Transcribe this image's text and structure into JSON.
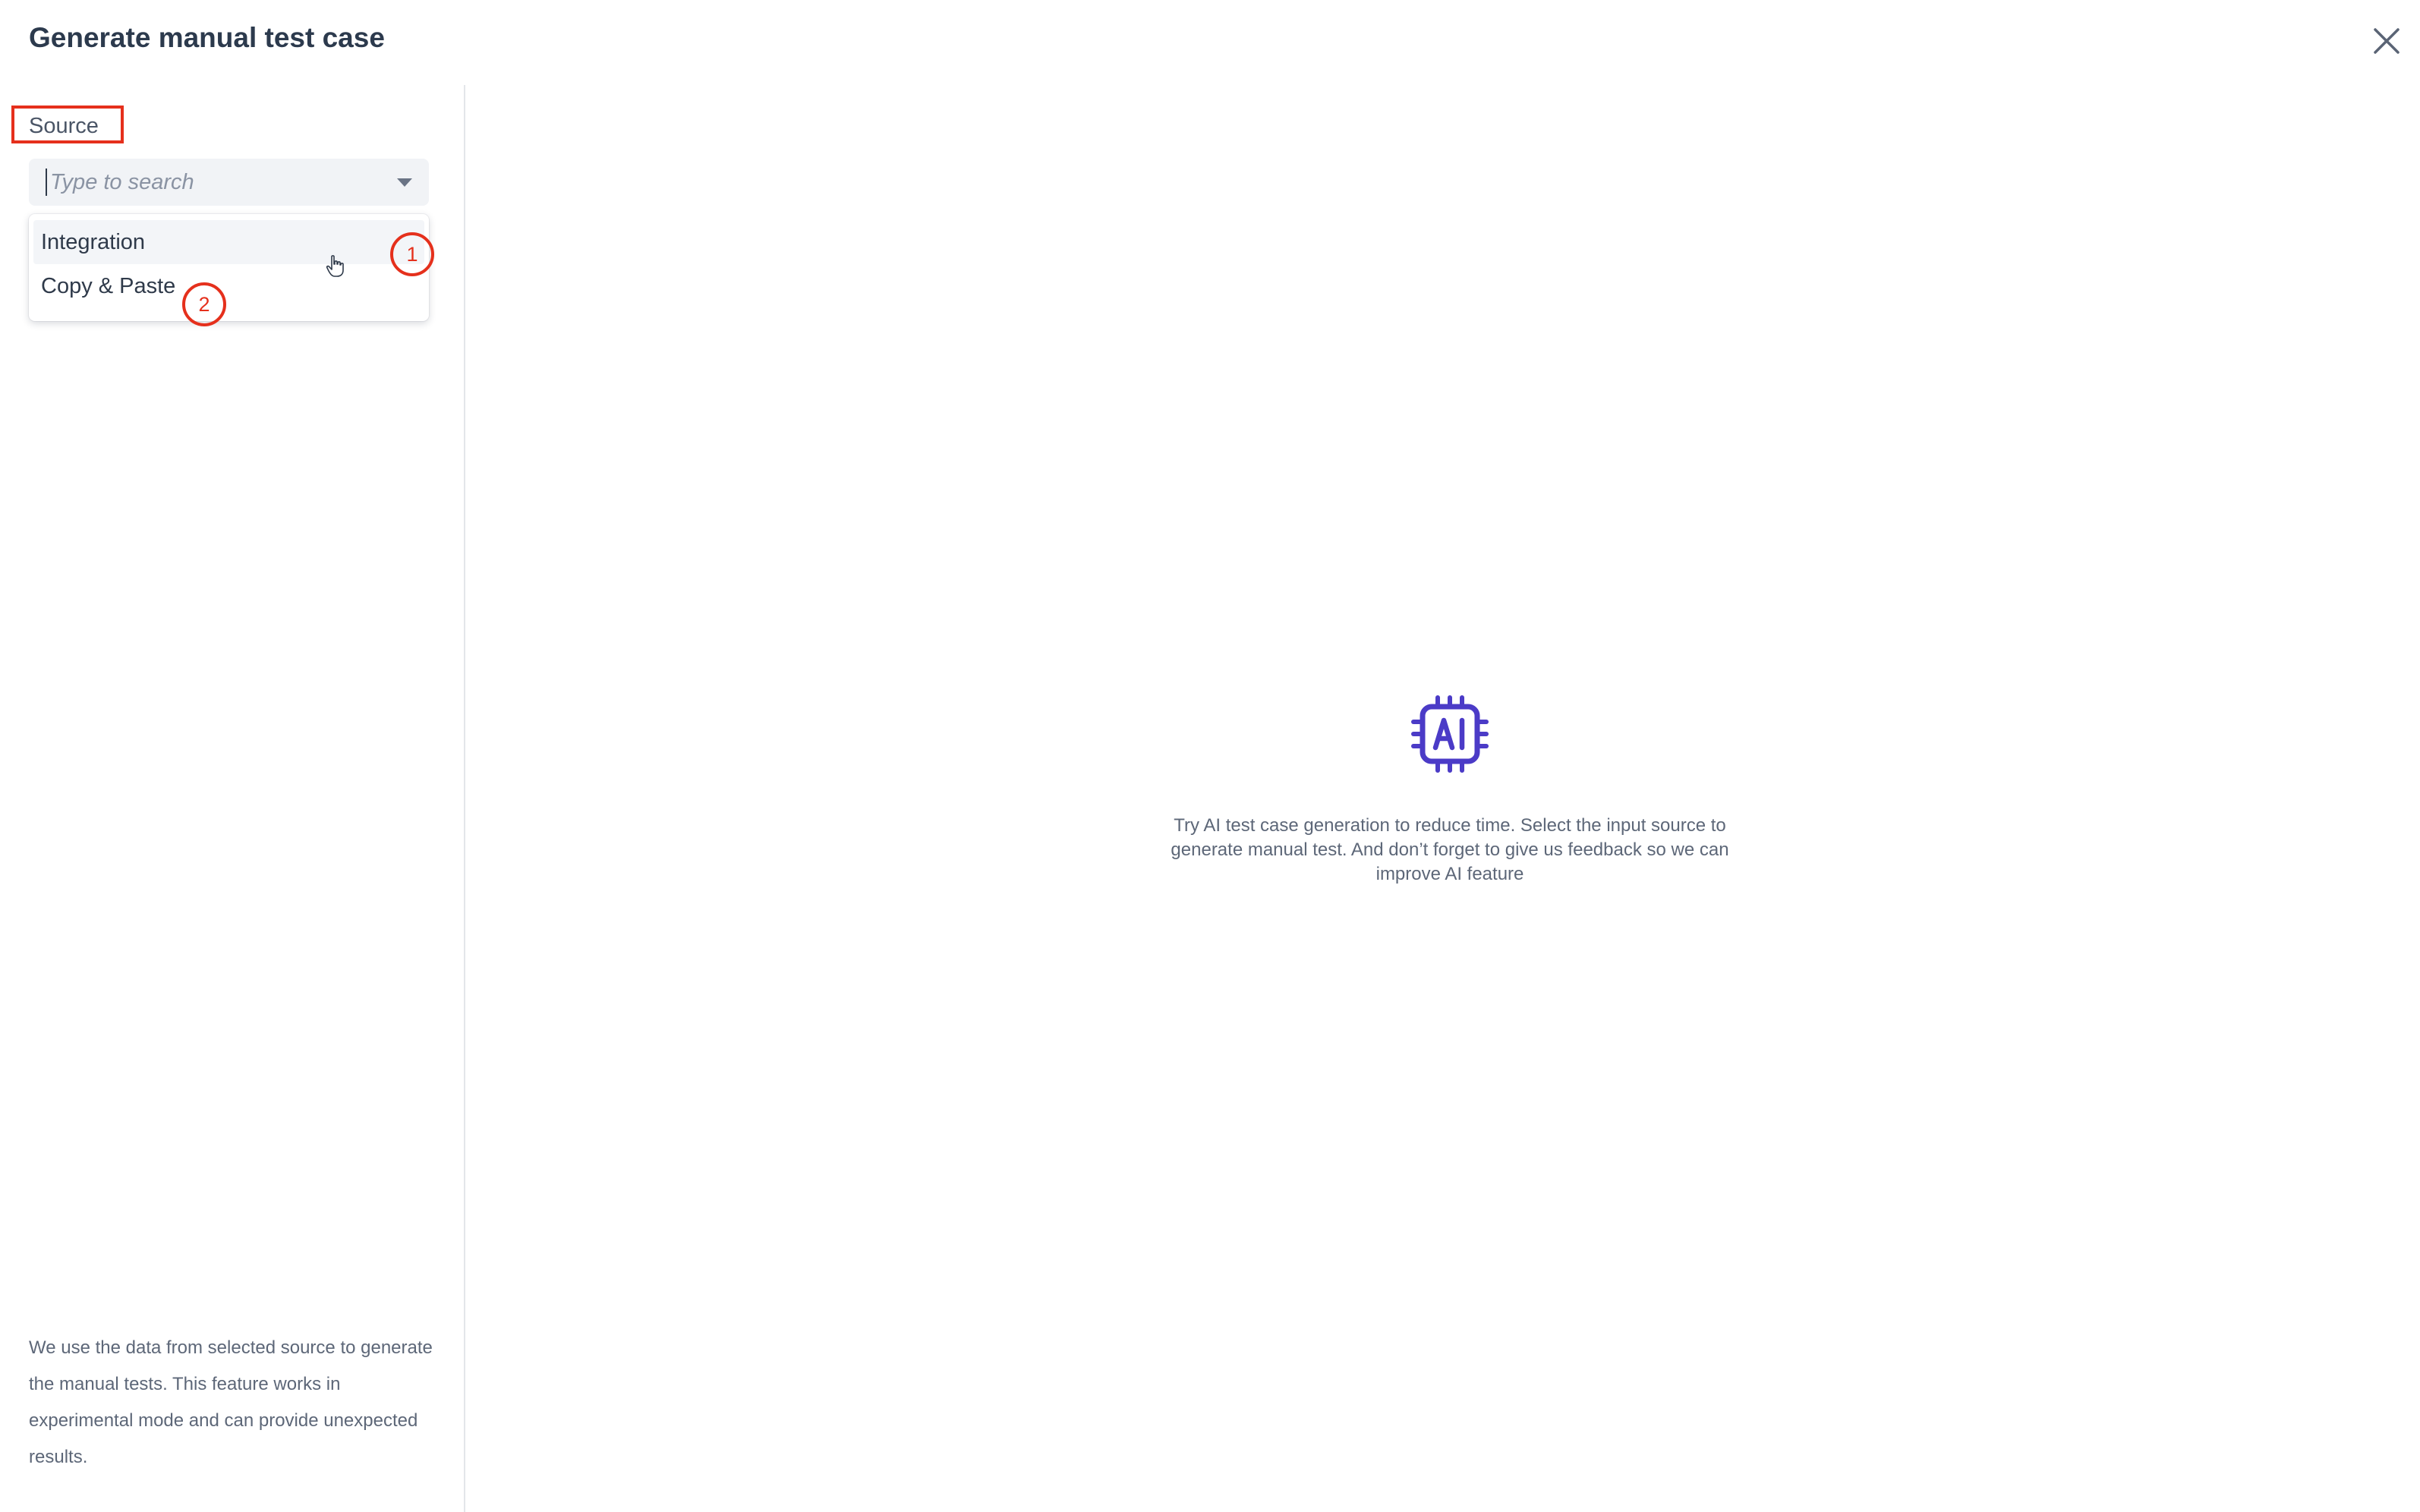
{
  "dialog": {
    "title": "Generate manual test case",
    "close_icon": "close-icon"
  },
  "source": {
    "label": "Source",
    "search_placeholder": "Type to search",
    "search_value": "",
    "dropdown_icon": "caret-down-icon",
    "options": [
      {
        "label": "Integration",
        "hovered": true
      },
      {
        "label": "Copy & Paste",
        "hovered": false
      }
    ]
  },
  "annotations": {
    "callout_1": "1",
    "callout_2": "2",
    "highlight_color": "#e5301c"
  },
  "disclaimer": "We use the data from selected source to generate the manual tests. This feature works in experimental mode and can provide unexpected results.",
  "empty_state": {
    "icon": "ai-chip-icon",
    "icon_color": "#4b3bc7",
    "message": "Try AI test case generation to reduce time. Select the input source to generate manual test. And don’t forget to give us feedback so we can improve AI feature"
  }
}
